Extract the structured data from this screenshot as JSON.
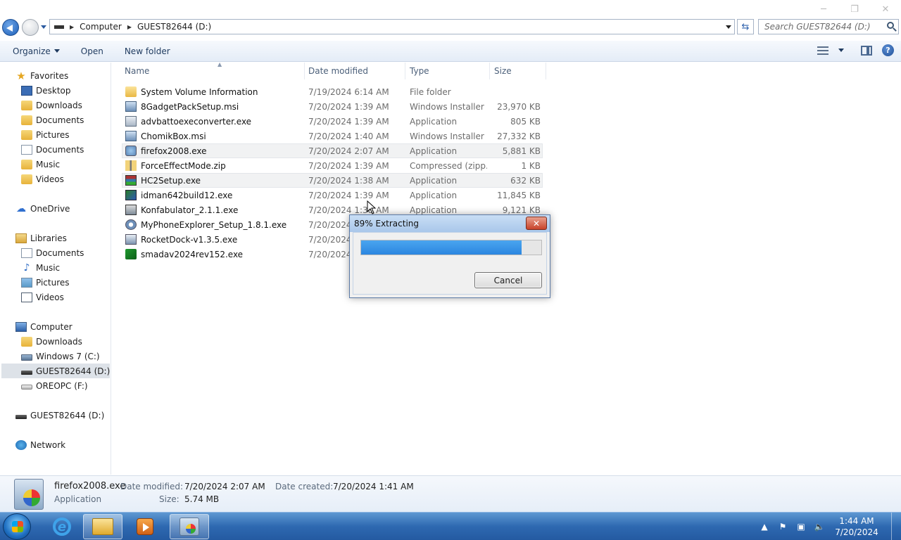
{
  "window": {
    "minimize_glyph": "─",
    "maximize_glyph": "❐",
    "close_glyph": "✕"
  },
  "address": {
    "crumbs": [
      "Computer",
      "GUEST82644 (D:)"
    ],
    "search_placeholder": "Search GUEST82644 (D:)"
  },
  "toolbar": {
    "organize": "Organize",
    "open": "Open",
    "new_folder": "New folder"
  },
  "nav": {
    "favorites": "Favorites",
    "fav_items": [
      "Desktop",
      "Downloads",
      "Documents",
      "Pictures",
      "Documents",
      "Music",
      "Videos"
    ],
    "onedrive": "OneDrive",
    "libraries": "Libraries",
    "lib_items": [
      "Documents",
      "Music",
      "Pictures",
      "Videos"
    ],
    "computer": "Computer",
    "comp_items": [
      "Downloads",
      "Windows 7 (C:)",
      "GUEST82644 (D:)",
      "OREOPC (F:)"
    ],
    "drive": "GUEST82644 (D:)",
    "network": "Network"
  },
  "columns": {
    "name": "Name",
    "date": "Date modified",
    "type": "Type",
    "size": "Size"
  },
  "files": [
    {
      "name": "System Volume Information",
      "date": "7/19/2024 6:14 AM",
      "type": "File folder",
      "size": "",
      "icon": "folder-icon"
    },
    {
      "name": "8GadgetPackSetup.msi",
      "date": "7/20/2024 1:39 AM",
      "type": "Windows Installer ...",
      "size": "23,970 KB",
      "icon": "msi-icon"
    },
    {
      "name": "advbattoexeconverter.exe",
      "date": "7/20/2024 1:39 AM",
      "type": "Application",
      "size": "805 KB",
      "icon": "exe-icon"
    },
    {
      "name": "ChomikBox.msi",
      "date": "7/20/2024 1:40 AM",
      "type": "Windows Installer ...",
      "size": "27,332 KB",
      "icon": "msi-icon"
    },
    {
      "name": "firefox2008.exe",
      "date": "7/20/2024 2:07 AM",
      "type": "Application",
      "size": "5,881 KB",
      "icon": "setup-icon"
    },
    {
      "name": "ForceEffectMode.zip",
      "date": "7/20/2024 1:39 AM",
      "type": "Compressed (zipp...",
      "size": "1 KB",
      "icon": "zip-icon"
    },
    {
      "name": "HC2Setup.exe",
      "date": "7/20/2024 1:38 AM",
      "type": "Application",
      "size": "632 KB",
      "icon": "winrar-icon"
    },
    {
      "name": "idman642build12.exe",
      "date": "7/20/2024 1:39 AM",
      "type": "Application",
      "size": "11,845 KB",
      "icon": "idm-icon"
    },
    {
      "name": "Konfabulator_2.1.1.exe",
      "date": "7/20/2024 1:38 AM",
      "type": "Application",
      "size": "9,121 KB",
      "icon": "konfabulator-icon"
    },
    {
      "name": "MyPhoneExplorer_Setup_1.8.1.exe",
      "date": "7/20/2024 1",
      "type": "",
      "size": "",
      "icon": "myphone-icon"
    },
    {
      "name": "RocketDock-v1.3.5.exe",
      "date": "7/20/2024 1",
      "type": "",
      "size": "",
      "icon": "rocketdock-icon"
    },
    {
      "name": "smadav2024rev152.exe",
      "date": "7/20/2024 1",
      "type": "",
      "size": "",
      "icon": "smadav-icon"
    }
  ],
  "dialog": {
    "title": "89% Extracting",
    "progress": 0.89,
    "cancel": "Cancel",
    "close_glyph": "✕"
  },
  "details": {
    "filename": "firefox2008.exe",
    "filetype": "Application",
    "date_modified_label": "Date modified:",
    "date_modified": "7/20/2024 2:07 AM",
    "date_created_label": "Date created:",
    "date_created": "7/20/2024 1:41 AM",
    "size_label": "Size:",
    "size": "5.74 MB"
  },
  "taskbar": {
    "time": "1:44 AM",
    "date": "7/20/2024",
    "ie_letter": "e"
  }
}
